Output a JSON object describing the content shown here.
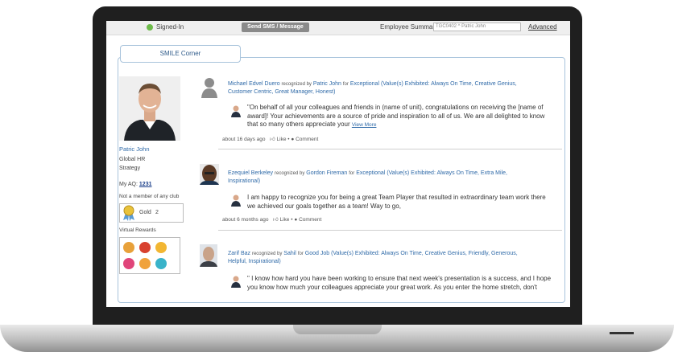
{
  "topbar": {
    "signed_in": "Signed-In",
    "send_sms": "Send SMS / Message",
    "employee_summary_label": "Employee Summary:",
    "employee_value": "TGC0402 ^ Patric John",
    "advanced": "Advanced"
  },
  "tab": {
    "label": "SMILE Corner"
  },
  "profile": {
    "name": "Patric John",
    "dept": "Global HR",
    "role": "Strategy",
    "aq_label": "My AQ:",
    "aq_value": "1231",
    "club": "Not a member of any club",
    "badge_label": "Gold",
    "badge_count": "2",
    "virtual_rewards": "Virtual Rewards"
  },
  "feed": [
    {
      "giver": "Michael Edvel Duero",
      "recognized_by": "recognized by",
      "receiver": "Patric John",
      "for_word": "for",
      "line1": "Exceptional (Value(s) Exhibited: Always On Time, Creative Genius,",
      "line2": "Customer Centric, Great Manager, Honest)",
      "quote1": "\"On behalf of all your colleagues and friends in (name of unit), congratulations on receiving the [name of",
      "quote2": "award]! Your achievements are a source of pride and inspiration to all of us. We are all delighted to know",
      "quote3": "that so many others appreciate your",
      "view_more": "View More",
      "time": "about 16 days ago",
      "like": "Like",
      "comment": "Comment"
    },
    {
      "giver": "Ezequiel Berkeley",
      "recognized_by": "recognized by",
      "receiver": "Gordon Fireman",
      "for_word": "for",
      "line1": "Exceptional (Value(s) Exhibited: Always On Time, Extra Mile,",
      "line2": "Inspirational)",
      "quote1": "I am happy to recognize you for being a great Team Player that resulted in extraordinary team work there",
      "quote2": "we achieved our goals together as a team! Way to go,",
      "time": "about 6 months ago",
      "like": "Like",
      "comment": "Comment"
    },
    {
      "giver": "Zarif Baz",
      "recognized_by": "recognized by",
      "receiver": "Sahil",
      "for_word": "for",
      "line1": "Good Job (Value(s) Exhibited: Always On Time, Creative Genius, Friendly, Generous,",
      "line2": "Helpful, Inspirational)",
      "quote1": "\" I know how hard you have been working to ensure that next week's presentation is a success, and I hope",
      "quote2": "you know how much your colleagues appreciate your great work. As you enter the home stretch, don't"
    }
  ],
  "icons": {
    "status": "green-dot-icon",
    "like": "thumbs-up-icon",
    "comment": "speech-bubble-icon",
    "badge": "ribbon-medal-icon"
  },
  "colors": {
    "link": "#2f6aa8",
    "status_green": "#6dbb4a",
    "panel_border": "#a9c4dc"
  }
}
